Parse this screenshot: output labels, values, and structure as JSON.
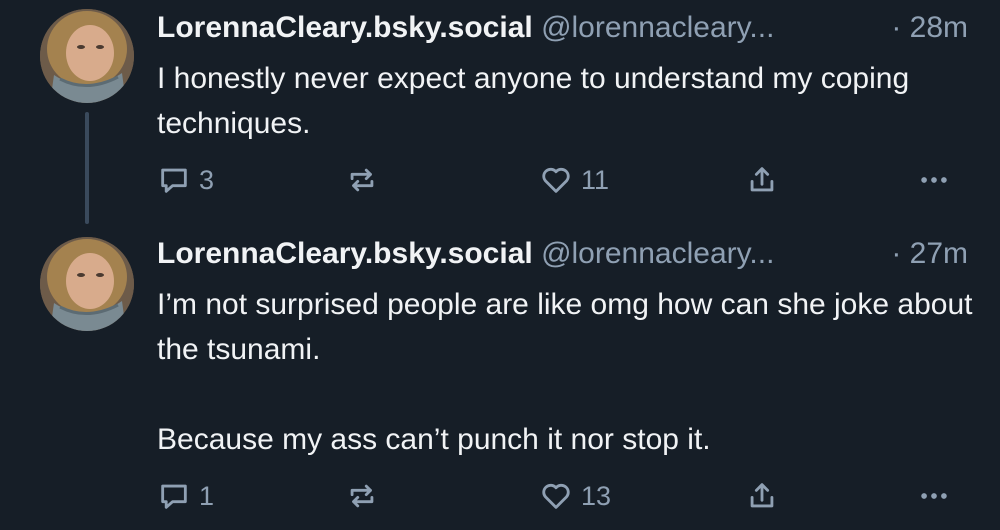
{
  "posts": [
    {
      "display_name": "LorennaCleary.bsky.social",
      "handle": "@lorennacleary...",
      "time": "· 28m",
      "paragraphs": [
        "I honestly never expect anyone to understand my coping techniques."
      ],
      "reply_count": "3",
      "repost_count": "",
      "like_count": "11"
    },
    {
      "display_name": "LorennaCleary.bsky.social",
      "handle": "@lorennacleary...",
      "time": "· 27m",
      "paragraphs": [
        "I’m not surprised people are like omg how can she joke about the tsunami.",
        "Because my ass can’t punch it nor stop it."
      ],
      "reply_count": "1",
      "repost_count": "",
      "like_count": "13"
    }
  ],
  "icons": {
    "reply": "speech-bubble-icon",
    "repost": "repost-arrows-icon",
    "like": "heart-icon",
    "share": "share-upload-icon",
    "more": "more-dots-icon"
  },
  "colors": {
    "background": "#161e27",
    "text": "#f1f3f5",
    "muted": "#8fa0b3",
    "thread_line": "#3a4a5c"
  }
}
